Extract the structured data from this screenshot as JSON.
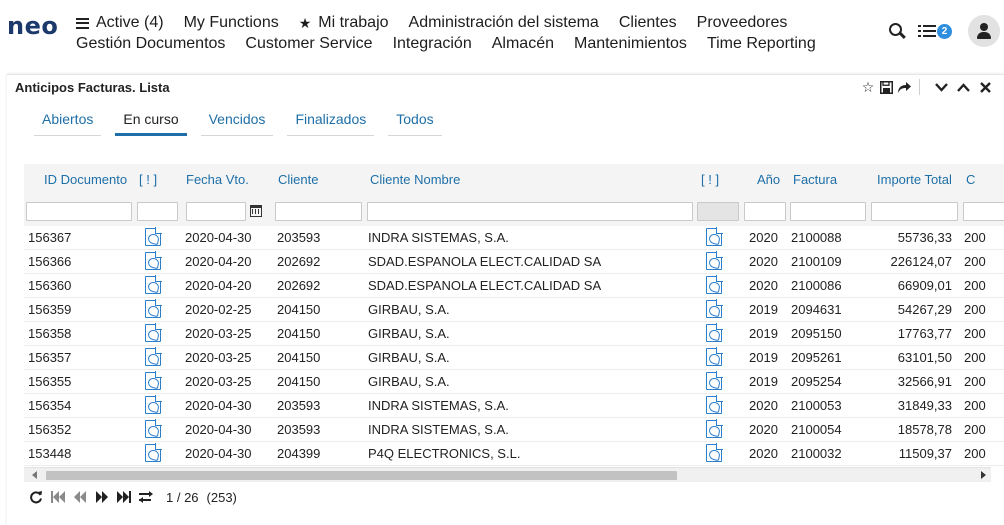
{
  "app": {
    "logo": "neo"
  },
  "menu": {
    "row1": [
      {
        "label": "Active (4)",
        "icon": "list-icon"
      },
      {
        "label": "My Functions"
      },
      {
        "label": "Mi trabajo",
        "icon": "star-icon"
      },
      {
        "label": "Administración del sistema"
      },
      {
        "label": "Clientes"
      },
      {
        "label": "Proveedores"
      }
    ],
    "row2": [
      {
        "label": "Gestión Documentos"
      },
      {
        "label": "Customer Service"
      },
      {
        "label": "Integración"
      },
      {
        "label": "Almacén"
      },
      {
        "label": "Mantenimientos"
      },
      {
        "label": "Time Reporting"
      }
    ]
  },
  "header_right": {
    "notification_count": "2"
  },
  "panel": {
    "title": "Anticipos Facturas. Lista",
    "tools": [
      "star-outline-icon",
      "save-icon",
      "share-icon",
      "chevron-down-icon",
      "chevron-up-icon",
      "close-icon"
    ]
  },
  "tabs": [
    {
      "label": "Abiertos",
      "active": false
    },
    {
      "label": "En curso",
      "active": true
    },
    {
      "label": "Vencidos",
      "active": false
    },
    {
      "label": "Finalizados",
      "active": false
    },
    {
      "label": "Todos",
      "active": false
    }
  ],
  "table": {
    "columns": [
      "ID Documento",
      "[ ! ]",
      "Fecha Vto.",
      "Cliente",
      "Cliente Nombre",
      "[ ! ]",
      "Año",
      "Factura",
      "Importe Total",
      "C"
    ],
    "rows": [
      {
        "id": "156367",
        "fecha": "2020-04-30",
        "cliente": "203593",
        "nombre": "INDRA SISTEMAS, S.A.",
        "anio": "2020",
        "factura": "2100088",
        "importe": "55736,33",
        "c": "200"
      },
      {
        "id": "156366",
        "fecha": "2020-04-20",
        "cliente": "202692",
        "nombre": "SDAD.ESPANOLA ELECT.CALIDAD SA",
        "anio": "2020",
        "factura": "2100109",
        "importe": "226124,07",
        "c": "200"
      },
      {
        "id": "156360",
        "fecha": "2020-04-20",
        "cliente": "202692",
        "nombre": "SDAD.ESPANOLA ELECT.CALIDAD SA",
        "anio": "2020",
        "factura": "2100086",
        "importe": "66909,01",
        "c": "200"
      },
      {
        "id": "156359",
        "fecha": "2020-02-25",
        "cliente": "204150",
        "nombre": "GIRBAU, S.A.",
        "anio": "2019",
        "factura": "2094631",
        "importe": "54267,29",
        "c": "200"
      },
      {
        "id": "156358",
        "fecha": "2020-03-25",
        "cliente": "204150",
        "nombre": "GIRBAU, S.A.",
        "anio": "2019",
        "factura": "2095150",
        "importe": "17763,77",
        "c": "200"
      },
      {
        "id": "156357",
        "fecha": "2020-03-25",
        "cliente": "204150",
        "nombre": "GIRBAU, S.A.",
        "anio": "2019",
        "factura": "2095261",
        "importe": "63101,50",
        "c": "200"
      },
      {
        "id": "156355",
        "fecha": "2020-03-25",
        "cliente": "204150",
        "nombre": "GIRBAU, S.A.",
        "anio": "2019",
        "factura": "2095254",
        "importe": "32566,91",
        "c": "200"
      },
      {
        "id": "156354",
        "fecha": "2020-04-30",
        "cliente": "203593",
        "nombre": "INDRA SISTEMAS, S.A.",
        "anio": "2020",
        "factura": "2100053",
        "importe": "31849,33",
        "c": "200"
      },
      {
        "id": "156352",
        "fecha": "2020-04-30",
        "cliente": "203593",
        "nombre": "INDRA SISTEMAS, S.A.",
        "anio": "2020",
        "factura": "2100054",
        "importe": "18578,78",
        "c": "200"
      },
      {
        "id": "153448",
        "fecha": "2020-04-30",
        "cliente": "204399",
        "nombre": "P4Q ELECTRONICS, S.L.",
        "anio": "2020",
        "factura": "2100032",
        "importe": "11509,37",
        "c": "200"
      }
    ]
  },
  "pager": {
    "page": "1 / 26",
    "total": "(253)"
  }
}
